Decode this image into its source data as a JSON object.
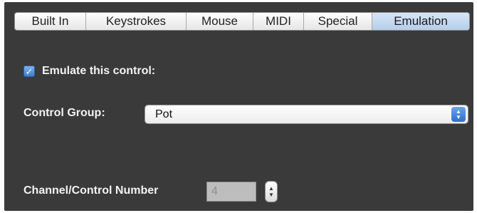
{
  "tabs": [
    {
      "label": "Built In",
      "selected": false
    },
    {
      "label": "Keystrokes",
      "selected": false
    },
    {
      "label": "Mouse",
      "selected": false
    },
    {
      "label": "MIDI",
      "selected": false
    },
    {
      "label": "Special",
      "selected": false
    },
    {
      "label": "Emulation",
      "selected": true
    }
  ],
  "emulate": {
    "label": "Emulate this control:",
    "checked": true
  },
  "control_group": {
    "label": "Control Group:",
    "value": "Pot"
  },
  "channel": {
    "label": "Channel/Control Number",
    "value": "4"
  },
  "icons": {
    "checkmark": "checkmark-icon",
    "popup_arrows": "up-down-arrows-icon",
    "stepper_arrows": "up-down-arrows-icon"
  },
  "colors": {
    "panel_background": "#3a3a3a",
    "selected_tab": "#c5d9f1",
    "accent_blue": "#3d7ed6",
    "label_text": "#f2f2f2"
  }
}
